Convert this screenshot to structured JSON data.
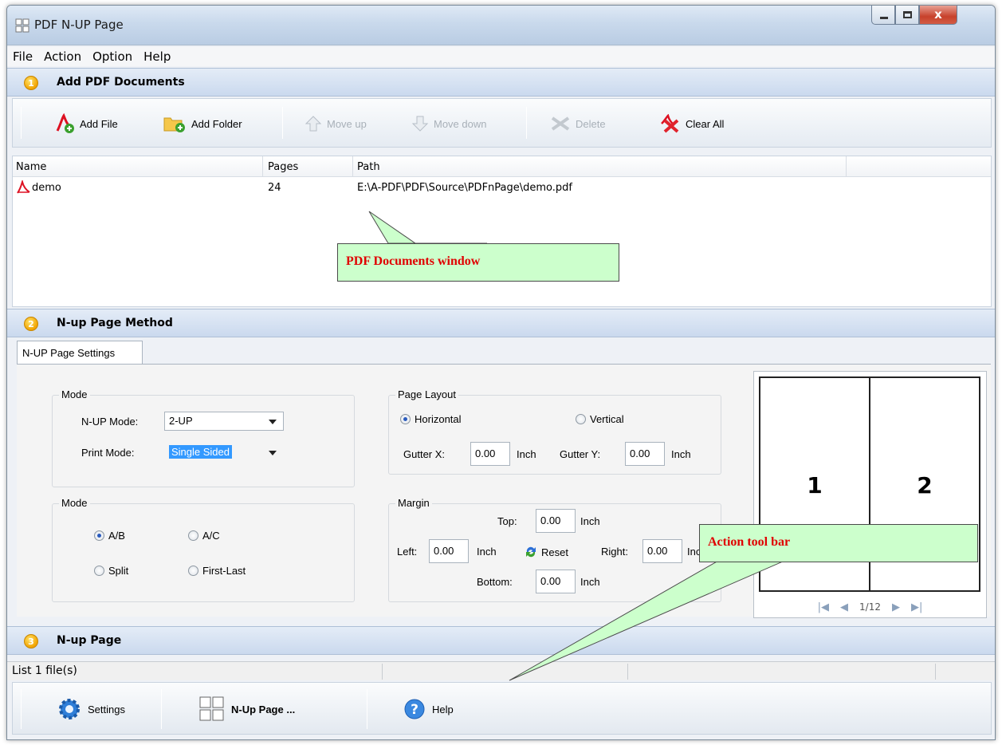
{
  "window": {
    "title": "PDF N-UP Page",
    "close_glyph": "x"
  },
  "menu": [
    "File",
    "Action",
    "Option",
    "Help"
  ],
  "sections": {
    "s1": {
      "num": "1",
      "label": "Add PDF Documents"
    },
    "s2": {
      "num": "2",
      "label": "N-up Page  Method"
    },
    "s3": {
      "num": "3",
      "label": "N-up Page"
    }
  },
  "toolbar": {
    "add_file": "Add File",
    "add_folder": "Add Folder",
    "move_up": "Move up",
    "move_down": "Move down",
    "delete": "Delete",
    "clear_all": "Clear All"
  },
  "file_list": {
    "columns": [
      "Name",
      "Pages",
      "Path"
    ],
    "rows": [
      {
        "name": "demo",
        "pages": "24",
        "path": "E:\\A-PDF\\PDF\\Source\\PDFnPage\\demo.pdf"
      }
    ]
  },
  "callouts": {
    "docs": "PDF Documents window",
    "action": "Action tool bar"
  },
  "settings_tab": "N-UP Page Settings",
  "mode_group": {
    "title": "Mode",
    "nup_label": "N-UP Mode:",
    "nup_value": "2-UP",
    "print_label": "Print Mode:",
    "print_value": "Single Sided"
  },
  "layout_group": {
    "title": "Page Layout",
    "horizontal": "Horizontal",
    "vertical": "Vertical",
    "selected": "Horizontal",
    "gutter_x_label": "Gutter X:",
    "gutter_x": "0.00",
    "gutter_y_label": "Gutter Y:",
    "gutter_y": "0.00",
    "unit": "Inch"
  },
  "order_group": {
    "title": "Mode",
    "ab": "A/B",
    "ac": "A/C",
    "split": "Split",
    "first_last": "First-Last",
    "selected": "A/B"
  },
  "margin_group": {
    "title": "Margin",
    "top_label": "Top:",
    "top": "0.00",
    "left_label": "Left:",
    "left": "0.00",
    "right_label": "Right:",
    "right": "0.00",
    "bottom_label": "Bottom:",
    "bottom": "0.00",
    "reset": "Reset",
    "unit": "Inch"
  },
  "preview": {
    "page1": "1",
    "page2": "2",
    "page_indicator": "1/12"
  },
  "status": {
    "text": "List 1 file(s)"
  },
  "actions": {
    "settings": "Settings",
    "nup": "N-Up Page ...",
    "help": "Help"
  }
}
